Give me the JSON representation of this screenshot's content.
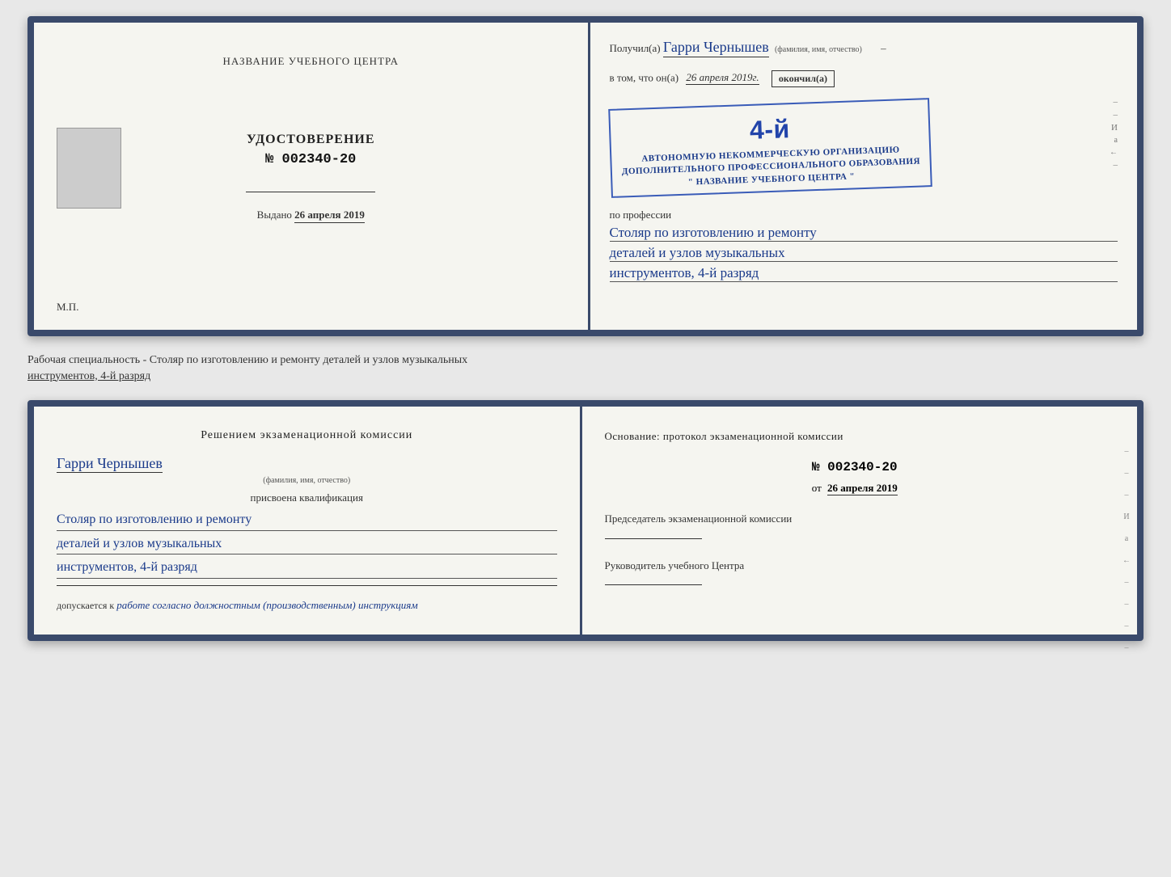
{
  "top_spread": {
    "left_page": {
      "top_title": "НАЗВАНИЕ УЧЕБНОГО ЦЕНТРА",
      "cert_title": "УДОСТОВЕРЕНИЕ",
      "cert_number_prefix": "№",
      "cert_number": "002340-20",
      "issued_label": "Выдано",
      "issued_date": "26 апреля 2019",
      "mp_label": "М.П."
    },
    "right_page": {
      "recipient_prefix": "Получил(а)",
      "recipient_name": "Гарри Чернышев",
      "recipient_subline": "(фамилия, имя, отчество)",
      "vtom_prefix": "в том, что он(а)",
      "vtom_date": "26 апреля 2019г.",
      "vtom_okoncil": "окончил(а)",
      "stamp_line1": "АВТОНОМНУЮ НЕКОММЕРЧЕСКУЮ ОРГАНИЗАЦИЮ",
      "stamp_line2": "ДОПОЛНИТЕЛЬНОГО ПРОФЕССИОНАЛЬНОГО ОБРАЗОВАНИЯ",
      "stamp_line3": "\" НАЗВАНИЕ УЧЕБНОГО ЦЕНТРА \"",
      "stamp_grade": "4-й",
      "profession_prefix": "по профессии",
      "profession_line1": "Столяр по изготовлению и ремонту",
      "profession_line2": "деталей и узлов музыкальных",
      "profession_line3": "инструментов, 4-й разряд"
    }
  },
  "caption": {
    "text1": "Рабочая специальность - Столяр по изготовлению и ремонту деталей и узлов музыкальных",
    "text2": "инструментов, 4-й разряд"
  },
  "bottom_spread": {
    "left_page": {
      "decision_title": "Решением экзаменационной комиссии",
      "name": "Гарри Чернышев",
      "name_subline": "(фамилия, имя, отчество)",
      "assigned_label": "присвоена квалификация",
      "qualification_line1": "Столяр по изготовлению и ремонту",
      "qualification_line2": "деталей и узлов музыкальных",
      "qualification_line3": "инструментов, 4-й разряд",
      "allowed_label": "допускается к",
      "allowed_value": "работе согласно должностным (производственным) инструкциям"
    },
    "right_page": {
      "basis_title": "Основание: протокол экзаменационной комиссии",
      "number_prefix": "№",
      "number": "002340-20",
      "date_prefix": "от",
      "date": "26 апреля 2019",
      "chairman_label": "Председатель экзаменационной комиссии",
      "director_label": "Руководитель учебного Центра",
      "right_edge_chars": [
        "И",
        "а",
        "←",
        "–",
        "–",
        "–",
        "–"
      ]
    }
  }
}
